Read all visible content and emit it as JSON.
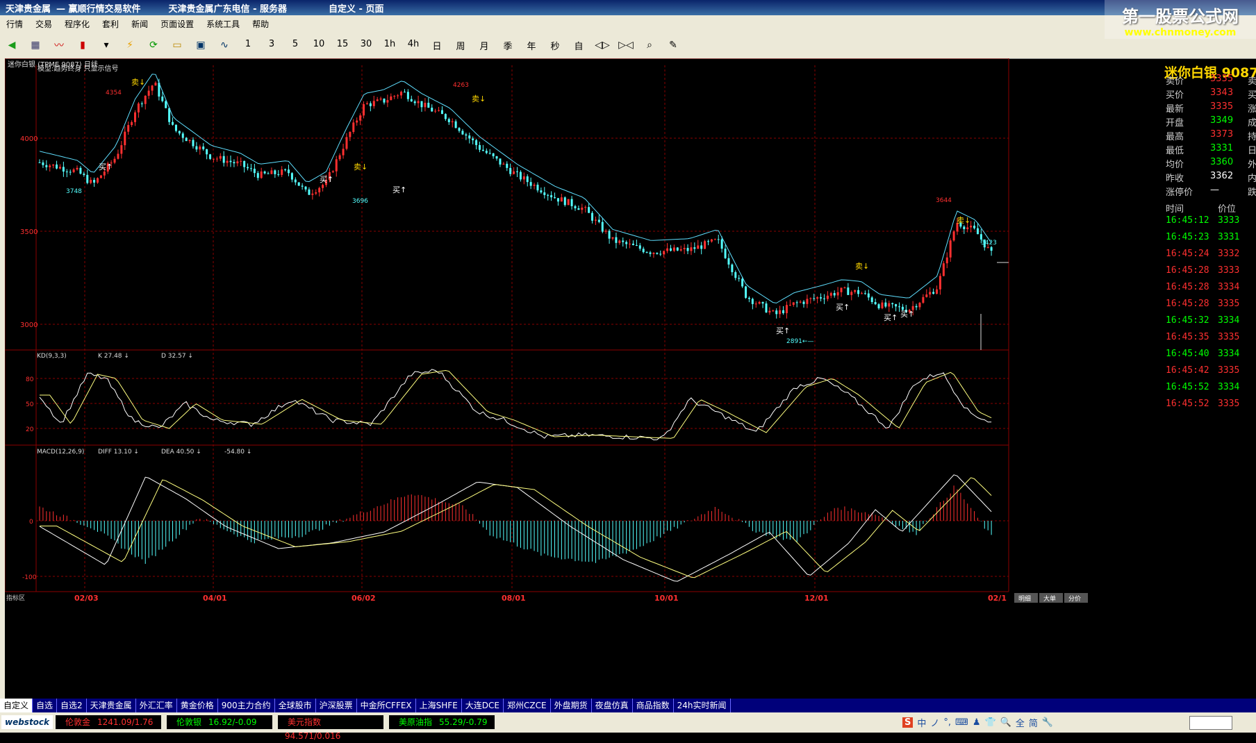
{
  "titlebar": {
    "app": "天津贵金属",
    "title": "— 赢顺行情交易软件",
    "server": "天津贵金属广东电信 - 服务器",
    "page": "自定义 - 页面"
  },
  "watermark": {
    "name": "第一股票公式网",
    "url": "www.chnmoney.com"
  },
  "menu": [
    "行情",
    "交易",
    "程序化",
    "套利",
    "新闻",
    "页面设置",
    "系统工具",
    "帮助"
  ],
  "toolbar": {
    "periods": [
      "1",
      "3",
      "5",
      "10",
      "15",
      "30",
      "1h",
      "4h",
      "日",
      "周",
      "月",
      "季",
      "年",
      "秒",
      "自"
    ]
  },
  "chart": {
    "main_title": "迷你白银 (TPME 9087) 日线",
    "model_label": "模型:趋势终身 只显示信号",
    "price_ticks": [
      "4000",
      "3500",
      "3000"
    ],
    "annotations": [
      "4354",
      "3748",
      "4263",
      "3696",
      "3644",
      "3423",
      "2891←—"
    ],
    "signals": {
      "buy": "买↑",
      "sell": "卖↓"
    },
    "kd": {
      "label": "KD(9,3,3)",
      "k": "K 27.48 ↓",
      "d": "D 32.57 ↓",
      "ticks": [
        "80",
        "50",
        "20"
      ]
    },
    "macd": {
      "label": "MACD(12,26,9)",
      "diff": "DIFF 13.10 ↓",
      "dea": "DEA 40.50 ↓",
      "macd": "-54.80 ↓",
      "ticks": [
        "0",
        "-100"
      ]
    },
    "indicator_area": "指标区",
    "dates": [
      "02/03",
      "04/01",
      "06/02",
      "08/01",
      "10/01",
      "12/01",
      "02/1"
    ],
    "bottom_tabs": [
      "明细",
      "大单",
      "分价"
    ],
    "colors": {
      "up": "#ff3030",
      "down": "#54ffff",
      "grid": "#8b0000",
      "ma": "#5fdfff"
    }
  },
  "quote": {
    "name": "迷你白银 9087",
    "rows": [
      {
        "label": "卖价",
        "value": "3335",
        "color": "#ff3030",
        "right": "卖"
      },
      {
        "label": "买价",
        "value": "3343",
        "color": "#ff3030",
        "right": "买"
      },
      {
        "label": "最新",
        "value": "3335",
        "color": "#ff3030",
        "right": "涨"
      },
      {
        "label": "开盘",
        "value": "3349",
        "color": "#00ff00",
        "right": "成"
      },
      {
        "label": "最高",
        "value": "3373",
        "color": "#ff3030",
        "right": "持"
      },
      {
        "label": "最低",
        "value": "3331",
        "color": "#00ff00",
        "right": "日"
      },
      {
        "label": "均价",
        "value": "3360",
        "color": "#00ff00",
        "right": "外"
      },
      {
        "label": "昨收",
        "value": "3362",
        "color": "#ffffff",
        "right": "内"
      },
      {
        "label": "涨停价",
        "value": "—",
        "color": "#ffffff",
        "right": "跌"
      }
    ],
    "tick_header": {
      "time": "时间",
      "price": "价位"
    },
    "ticks": [
      {
        "time": "16:45:12",
        "price": "3333",
        "color": "#00ff00"
      },
      {
        "time": "16:45:23",
        "price": "3331",
        "color": "#00ff00"
      },
      {
        "time": "16:45:24",
        "price": "3332",
        "color": "#ff3030"
      },
      {
        "time": "16:45:28",
        "price": "3333",
        "color": "#ff3030"
      },
      {
        "time": "16:45:28",
        "price": "3334",
        "color": "#ff3030"
      },
      {
        "time": "16:45:28",
        "price": "3335",
        "color": "#ff3030"
      },
      {
        "time": "16:45:32",
        "price": "3334",
        "color": "#00ff00"
      },
      {
        "time": "16:45:35",
        "price": "3335",
        "color": "#ff3030"
      },
      {
        "time": "16:45:40",
        "price": "3334",
        "color": "#00ff00"
      },
      {
        "time": "16:45:42",
        "price": "3335",
        "color": "#ff3030"
      },
      {
        "time": "16:45:52",
        "price": "3334",
        "color": "#00ff00"
      },
      {
        "time": "16:45:52",
        "price": "3335",
        "color": "#ff3030"
      }
    ]
  },
  "tabs": [
    "自定义",
    "自选",
    "自选2",
    "天津贵金属",
    "外汇汇率",
    "黄金价格",
    "900主力合约",
    "全球股市",
    "沪深股票",
    "中金所CFFEX",
    "上海SHFE",
    "大连DCE",
    "郑州CZCE",
    "外盘期货",
    "夜盘仿真",
    "商品指数",
    "24h实时新闻"
  ],
  "status": {
    "logo": "webstock",
    "items": [
      {
        "name": "伦敦金",
        "value": "1241.09/1.76",
        "color": "#ff3030"
      },
      {
        "name": "伦敦银",
        "value": "16.92/-0.09",
        "color": "#00ff00"
      },
      {
        "name": "美元指数",
        "value": "94.571/0.016",
        "color": "#ff3030"
      },
      {
        "name": "美原油指",
        "value": "55.29/-0.79",
        "color": "#00ff00"
      }
    ],
    "ime": [
      "中",
      "ノ",
      "°,",
      "⌨",
      "♟",
      "👕",
      "🔍",
      "全",
      "简",
      "🔧"
    ]
  }
}
